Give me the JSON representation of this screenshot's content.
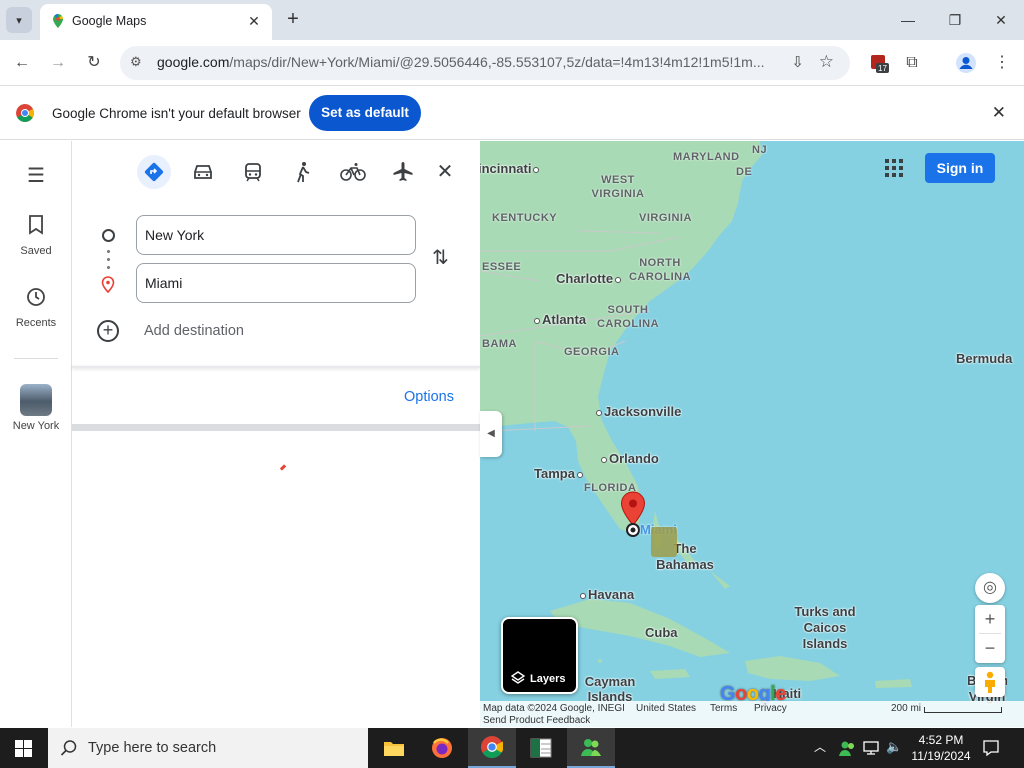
{
  "browser": {
    "tab_title": "Google Maps",
    "url_host": "google.com",
    "url_path": "/maps/dir/New+York/Miami/@29.5056446,-85.553107,5z/data=!4m13!4m12!1m5!1m...",
    "extension_badge": "17",
    "infobar_text": "Google Chrome isn't your default browser",
    "infobar_button": "Set as default"
  },
  "rail": {
    "items": [
      {
        "label": "Saved",
        "icon": "bookmark-icon"
      },
      {
        "label": "Recents",
        "icon": "history-icon"
      },
      {
        "label": "New York",
        "icon": "new-york-thumbnail"
      }
    ]
  },
  "directions": {
    "modes": [
      "best",
      "driving",
      "transit",
      "walking",
      "cycling",
      "flight"
    ],
    "origin": "New York",
    "destination": "Miami",
    "add_destination": "Add destination",
    "options_label": "Options"
  },
  "map": {
    "sign_in": "Sign in",
    "layers_label": "Layers",
    "states": [
      "MARYLAND",
      "NJ",
      "DE",
      "WEST VIRGINIA",
      "VIRGINIA",
      "KENTUCKY",
      "NORTH CAROLINA",
      "ESSEE",
      "SOUTH CAROLINA",
      "BAMA",
      "GEORGIA",
      "FLORIDA"
    ],
    "cities": [
      "incinnati",
      "Charlotte",
      "Atlanta",
      "Jacksonville",
      "Orlando",
      "Tampa",
      "Havana",
      "Miami"
    ],
    "regions": [
      "Bermuda",
      "The Bahamas",
      "Cuba",
      "Turks and Caicos Islands",
      "Cayman Islands",
      "Haiti",
      "British Virgin"
    ],
    "logo": "Google",
    "footer": {
      "attribution": "Map data ©2024 Google, INEGI",
      "country": "United States",
      "terms": "Terms",
      "privacy": "Privacy",
      "feedback": "Send Product Feedback",
      "scale": "200 mi"
    },
    "accent_color": "#1a73e8",
    "pin_color": "#ea4335"
  },
  "taskbar": {
    "search_placeholder": "Type here to search",
    "time": "4:52 PM",
    "date": "11/19/2024"
  }
}
